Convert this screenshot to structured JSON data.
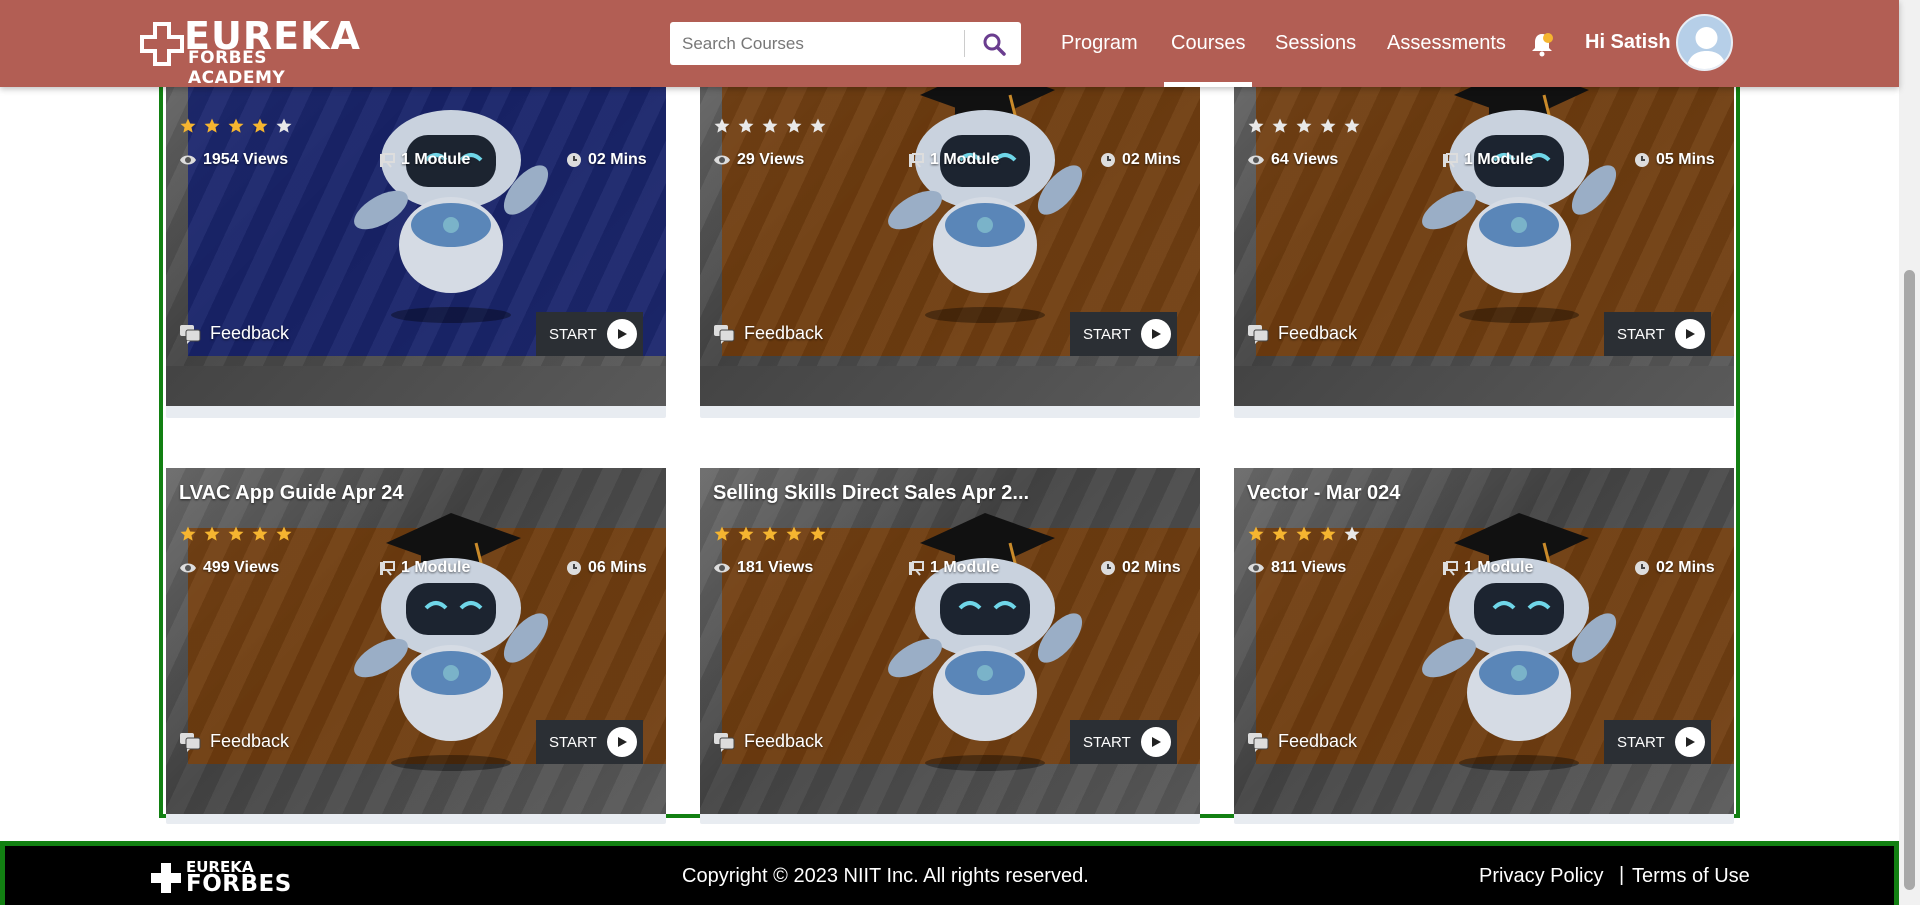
{
  "header": {
    "logo_top": "EUREKA",
    "logo_bottom": "FORBES ACADEMY",
    "search_placeholder": "Search Courses",
    "nav": [
      {
        "label": "Program"
      },
      {
        "label": "Courses",
        "active": true
      },
      {
        "label": "Sessions"
      },
      {
        "label": "Assessments"
      }
    ],
    "greeting": "Hi Satish"
  },
  "colors": {
    "header_bg": "#b25e54",
    "frame_border": "#128012",
    "star_filled": "#f5b530",
    "star_empty": "#e8e8e8",
    "panel_blue": "#0c1a73",
    "panel_orange": "#7a3a00"
  },
  "courses": [
    {
      "title": "",
      "rating": 4,
      "views": "1954 Views",
      "modules": "1 Module",
      "duration": "02 Mins",
      "feedback": "Feedback",
      "start": "START",
      "theme": "blue"
    },
    {
      "title": "",
      "rating": 0,
      "views": "29 Views",
      "modules": "1 Module",
      "duration": "02 Mins",
      "feedback": "Feedback",
      "start": "START",
      "theme": "orange"
    },
    {
      "title": "",
      "rating": 0,
      "views": "64 Views",
      "modules": "1 Module",
      "duration": "05 Mins",
      "feedback": "Feedback",
      "start": "START",
      "theme": "orange"
    },
    {
      "title": "LVAC App Guide Apr 24",
      "rating": 5,
      "views": "499 Views",
      "modules": "1 Module",
      "duration": "06 Mins",
      "feedback": "Feedback",
      "start": "START",
      "theme": "orange"
    },
    {
      "title": "Selling Skills Direct Sales Apr 2...",
      "rating": 5,
      "views": "181 Views",
      "modules": "1 Module",
      "duration": "02 Mins",
      "feedback": "Feedback",
      "start": "START",
      "theme": "orange"
    },
    {
      "title": "Vector - Mar 024",
      "rating": 4,
      "views": "811 Views",
      "modules": "1 Module",
      "duration": "02 Mins",
      "feedback": "Feedback",
      "start": "START",
      "theme": "orange"
    }
  ],
  "footer": {
    "logo_top": "EUREKA",
    "logo_bottom": "FORBES",
    "copyright": "Copyright © 2023 NIIT Inc. All rights reserved.",
    "privacy": "Privacy Policy",
    "separator": "|",
    "terms": "Terms of Use"
  }
}
